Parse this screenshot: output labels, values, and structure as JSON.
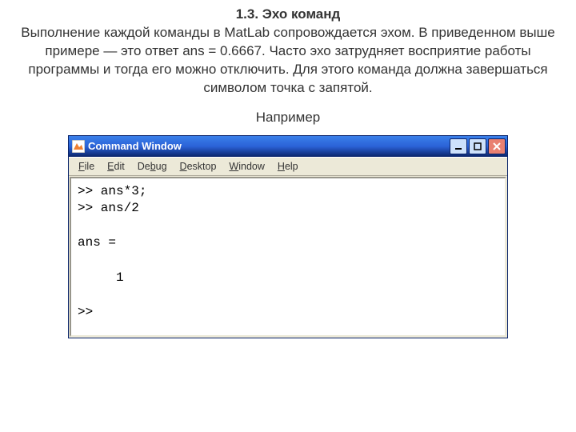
{
  "doc": {
    "heading": "1.3. Эхо команд",
    "paragraph": "Выполнение каждой команды в MatLab сопровождается эхом. В приведенном выше примере — это ответ ans = 0.6667. Часто эхо затрудняет восприятие работы программы и тогда его можно отключить. Для этого команда должна завершаться символом точка с запятой.",
    "example_label": "Например"
  },
  "window": {
    "title": "Command Window",
    "min_label": "–",
    "max_label": "□",
    "close_label": "×"
  },
  "menu": {
    "file": "File",
    "edit": "Edit",
    "debug": "Debug",
    "desktop": "Desktop",
    "window": "Window",
    "help": "Help"
  },
  "console": {
    "line1": ">> ans*3;",
    "line2": ">> ans/2",
    "blank": "",
    "line3": "ans =",
    "line4": "     1",
    "prompt": ">>"
  }
}
